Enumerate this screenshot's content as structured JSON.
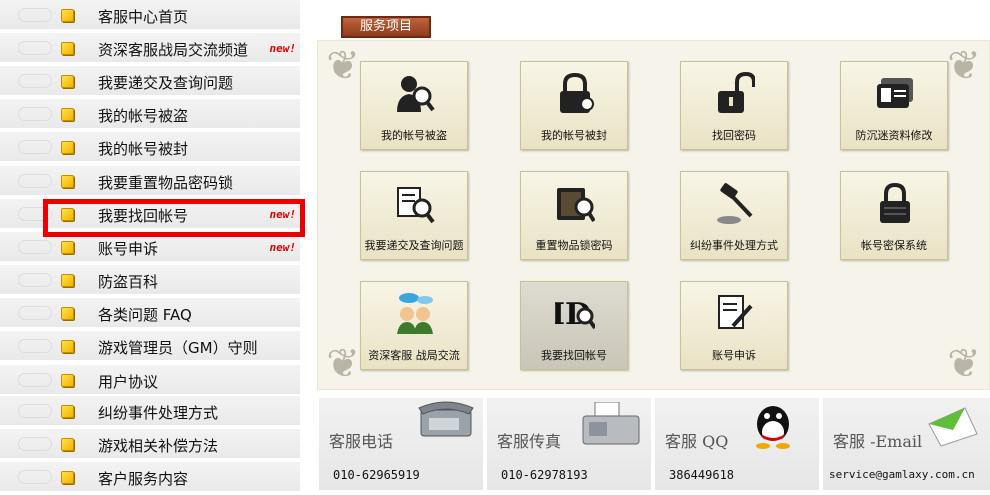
{
  "sidebar": {
    "items": [
      {
        "label": "客服中心首页",
        "badge": ""
      },
      {
        "label": "资深客服战局交流频道",
        "badge": "new!"
      },
      {
        "label": "我要递交及查询问题",
        "badge": ""
      },
      {
        "label": "我的帐号被盗",
        "badge": ""
      },
      {
        "label": "我的帐号被封",
        "badge": ""
      },
      {
        "label": "我要重置物品密码锁",
        "badge": ""
      },
      {
        "label": "我要找回帐号",
        "badge": "new!"
      },
      {
        "label": "账号申诉",
        "badge": "new!"
      },
      {
        "label": "防盗百科",
        "badge": ""
      },
      {
        "label": "各类问题 FAQ",
        "badge": ""
      },
      {
        "label": "游戏管理员（GM）守则",
        "badge": ""
      },
      {
        "label": "用户协议",
        "badge": ""
      },
      {
        "label": "纠纷事件处理方式",
        "badge": ""
      },
      {
        "label": "游戏相关补偿方法",
        "badge": ""
      },
      {
        "label": "客户服务内容",
        "badge": ""
      }
    ]
  },
  "services": {
    "title": "服务项目",
    "tiles": [
      {
        "label": "我的帐号被盗",
        "icon": "person-magnifier-icon"
      },
      {
        "label": "我的帐号被封",
        "icon": "locked-padlock-icon"
      },
      {
        "label": "找回密码",
        "icon": "unlocked-padlock-icon"
      },
      {
        "label": "防沉迷资料修改",
        "icon": "id-card-icon"
      },
      {
        "label": "我要递交及查询问题",
        "icon": "document-magnifier-icon"
      },
      {
        "label": "重置物品锁密码",
        "icon": "safe-magnifier-icon"
      },
      {
        "label": "纠纷事件处理方式",
        "icon": "gavel-icon"
      },
      {
        "label": "帐号密保系统",
        "icon": "padlock-icon"
      },
      {
        "label": "资深客服 战局交流",
        "icon": "chat-people-icon"
      },
      {
        "label": "我要找回帐号",
        "icon": "id-magnifier-icon"
      },
      {
        "label": "账号申诉",
        "icon": "document-pen-icon"
      }
    ]
  },
  "contacts": [
    {
      "title": "客服电话",
      "value": "010-62965919",
      "icon": "telephone-icon"
    },
    {
      "title": "客服传真",
      "value": "010-62978193",
      "icon": "fax-machine-icon"
    },
    {
      "title": "客服 QQ",
      "value": "386449618",
      "icon": "qq-penguin-icon"
    },
    {
      "title": "客服 -Email",
      "value": "service@gamlaxy.com.cn",
      "icon": "envelope-icon"
    }
  ],
  "colors": {
    "accent_red": "#ee0000",
    "bullet_yellow": "#f0b400",
    "tab_brown": "#8f3b1d"
  }
}
